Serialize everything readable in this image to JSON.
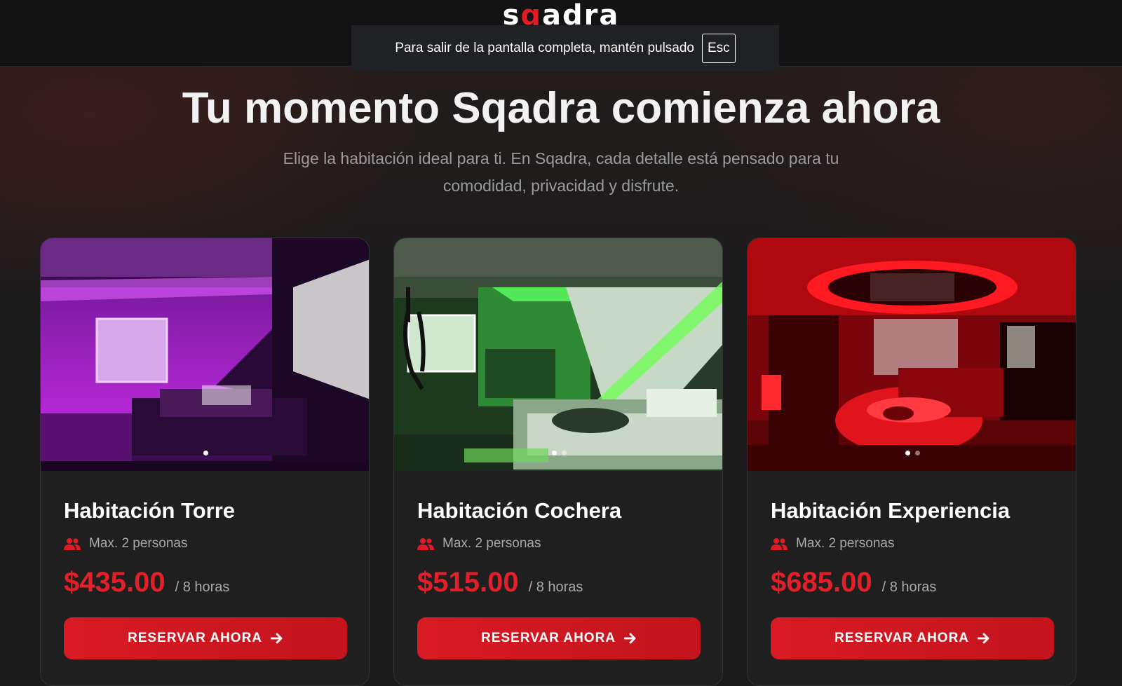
{
  "header": {
    "logo_text": "sqadra",
    "logo_main_a": "s",
    "logo_accent": "q",
    "logo_main_b": "adra"
  },
  "fullscreen_notice": {
    "message": "Para salir de la pantalla completa, mantén pulsado",
    "key": "Esc"
  },
  "hero": {
    "title": "Tu momento Sqadra comienza ahora",
    "subtitle": "Elige la habitación ideal para ti. En Sqadra, cada detalle está pensado para tu comodidad, privacidad y disfrute."
  },
  "rooms": [
    {
      "name": "Habitación Torre",
      "capacity": "Max. 2 personas",
      "price": "$435.00",
      "period": "/ 8 horas",
      "cta": "RESERVAR AHORA",
      "theme": "#b01fd0",
      "image_slides": 1,
      "active_slide": 1
    },
    {
      "name": "Habitación Cochera",
      "capacity": "Max. 2 personas",
      "price": "$515.00",
      "period": "/ 8 horas",
      "cta": "RESERVAR AHORA",
      "theme": "#2fd13a",
      "image_slides": 2,
      "active_slide": 1
    },
    {
      "name": "Habitación Experiencia",
      "capacity": "Max. 2 personas",
      "price": "$685.00",
      "period": "/ 8 horas",
      "cta": "RESERVAR AHORA",
      "theme": "#e1121c",
      "image_slides": 2,
      "active_slide": 1
    }
  ],
  "colors": {
    "accent": "#e11b25",
    "price": "#e3202a",
    "background": "#1b1b1c"
  },
  "icons": {
    "capacity": "users-icon",
    "cta": "arrow-right-icon"
  }
}
